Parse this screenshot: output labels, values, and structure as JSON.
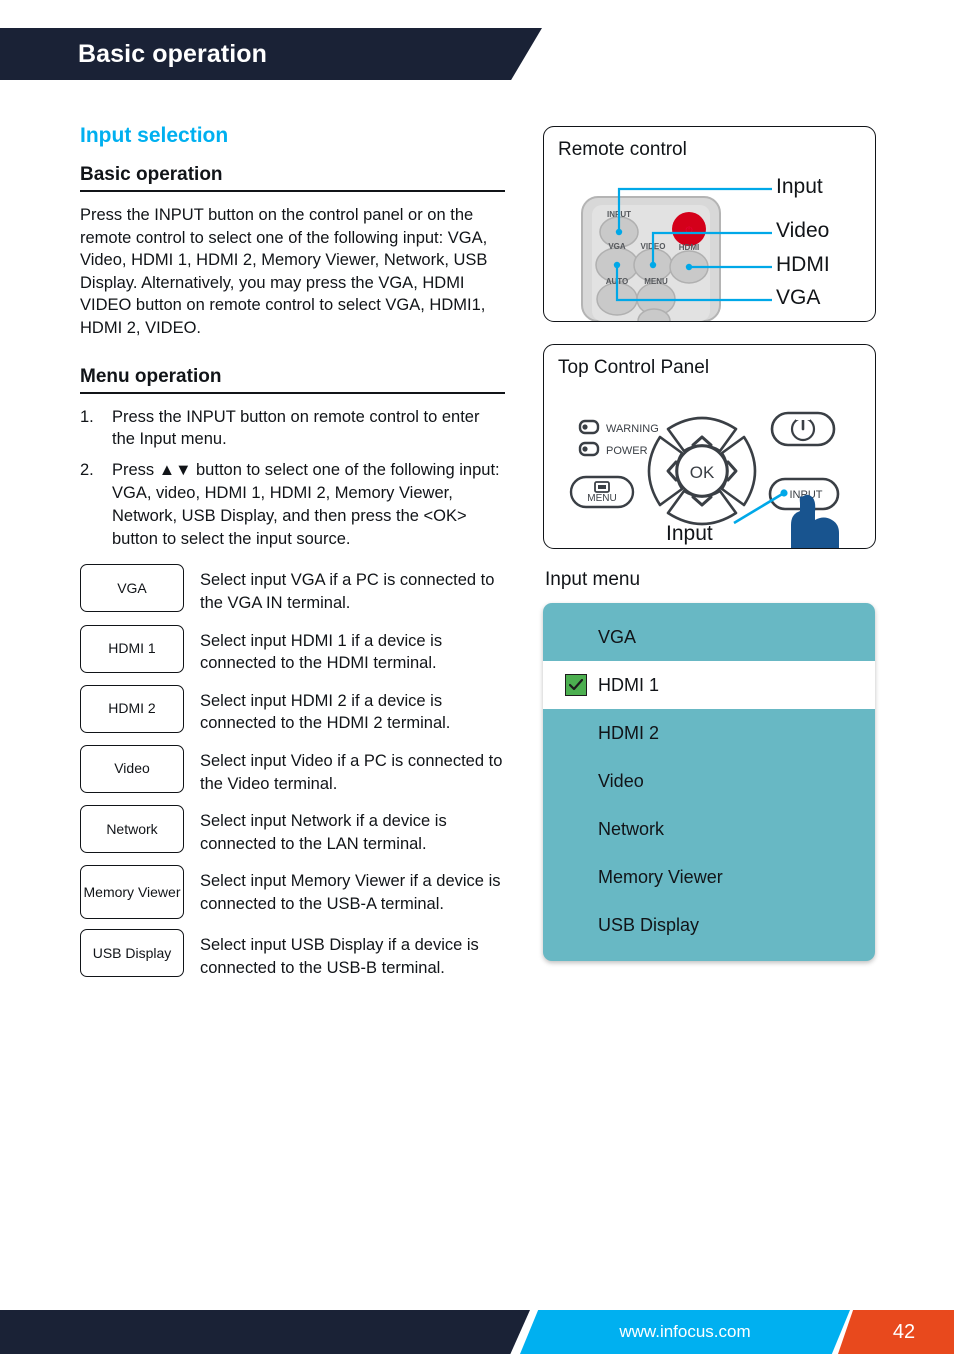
{
  "header": {
    "title": "Basic operation"
  },
  "left": {
    "section_title": "Input selection",
    "sub_head_1": "Basic operation",
    "paragraph_1": "Press the INPUT button on the control panel or on the remote control to select one of the following input: VGA, Video, HDMI 1, HDMI 2, Memory Viewer, Network, USB Display. Alternatively, you may press the VGA, HDMI VIDEO button on remote control to select VGA, HDMI1, HDMI 2, VIDEO.",
    "sub_head_2": "Menu operation",
    "steps": [
      {
        "num": "1.",
        "text": "Press the INPUT button on remote control to enter the Input menu."
      },
      {
        "num": "2.",
        "text": "Press ▲▼ button to select one of the following input: VGA, video, HDMI 1, HDMI 2, Memory Viewer, Network, USB Display, and then press the <OK> button to select the input source."
      }
    ],
    "key_rows": [
      {
        "key": "VGA",
        "desc": "Select input VGA if a PC is connected to the VGA IN terminal."
      },
      {
        "key": "HDMI 1",
        "desc": "Select input HDMI 1 if a device is connected to the HDMI terminal."
      },
      {
        "key": "HDMI 2",
        "desc": "Select input HDMI 2 if a device is connected to the HDMI 2 terminal."
      },
      {
        "key": "Video",
        "desc": "Select input Video if a PC is connected to the Video terminal."
      },
      {
        "key": "Network",
        "desc": "Select input Network if a device is connected to the LAN terminal."
      },
      {
        "key": "Memory Viewer",
        "desc": "Select input Memory Viewer if a device is connected to the USB-A terminal."
      },
      {
        "key": "USB Display",
        "desc": "Select input USB Display if a device is connected to the USB-B terminal."
      }
    ]
  },
  "remote_panel": {
    "title": "Remote control",
    "callouts": [
      {
        "label": "Input"
      },
      {
        "label": "Video"
      },
      {
        "label": "HDMI"
      },
      {
        "label": "VGA"
      }
    ],
    "buttons": {
      "input": "INPUT",
      "vga": "VGA",
      "video": "VIDEO",
      "hdmi": "HDMI",
      "auto": "AUTO",
      "menu": "MENU"
    },
    "power_icon": "power-icon"
  },
  "control_panel": {
    "title": "Top Control Panel",
    "indicators": [
      "WARNING",
      "POWER"
    ],
    "menu_button": "MENU",
    "ok_button": "OK",
    "input_button": "INPUT",
    "callout": "Input",
    "power_icon": "power-icon"
  },
  "input_menu": {
    "caption": "Input menu",
    "items": [
      {
        "label": "VGA",
        "selected": false
      },
      {
        "label": "HDMI 1",
        "selected": true
      },
      {
        "label": "HDMI 2",
        "selected": false
      },
      {
        "label": "Video",
        "selected": false
      },
      {
        "label": "Network",
        "selected": false
      },
      {
        "label": "Memory Viewer",
        "selected": false
      },
      {
        "label": "USB Display",
        "selected": false
      }
    ]
  },
  "footer": {
    "url": "www.infocus.com",
    "page": "42"
  },
  "colors": {
    "navy": "#1a2236",
    "cyan": "#00b0f0",
    "orange": "#e8491d",
    "teal": "#68b8c4",
    "check_green": "#4caf50",
    "hand_blue": "#18548f",
    "remote_red": "#d4001a"
  }
}
